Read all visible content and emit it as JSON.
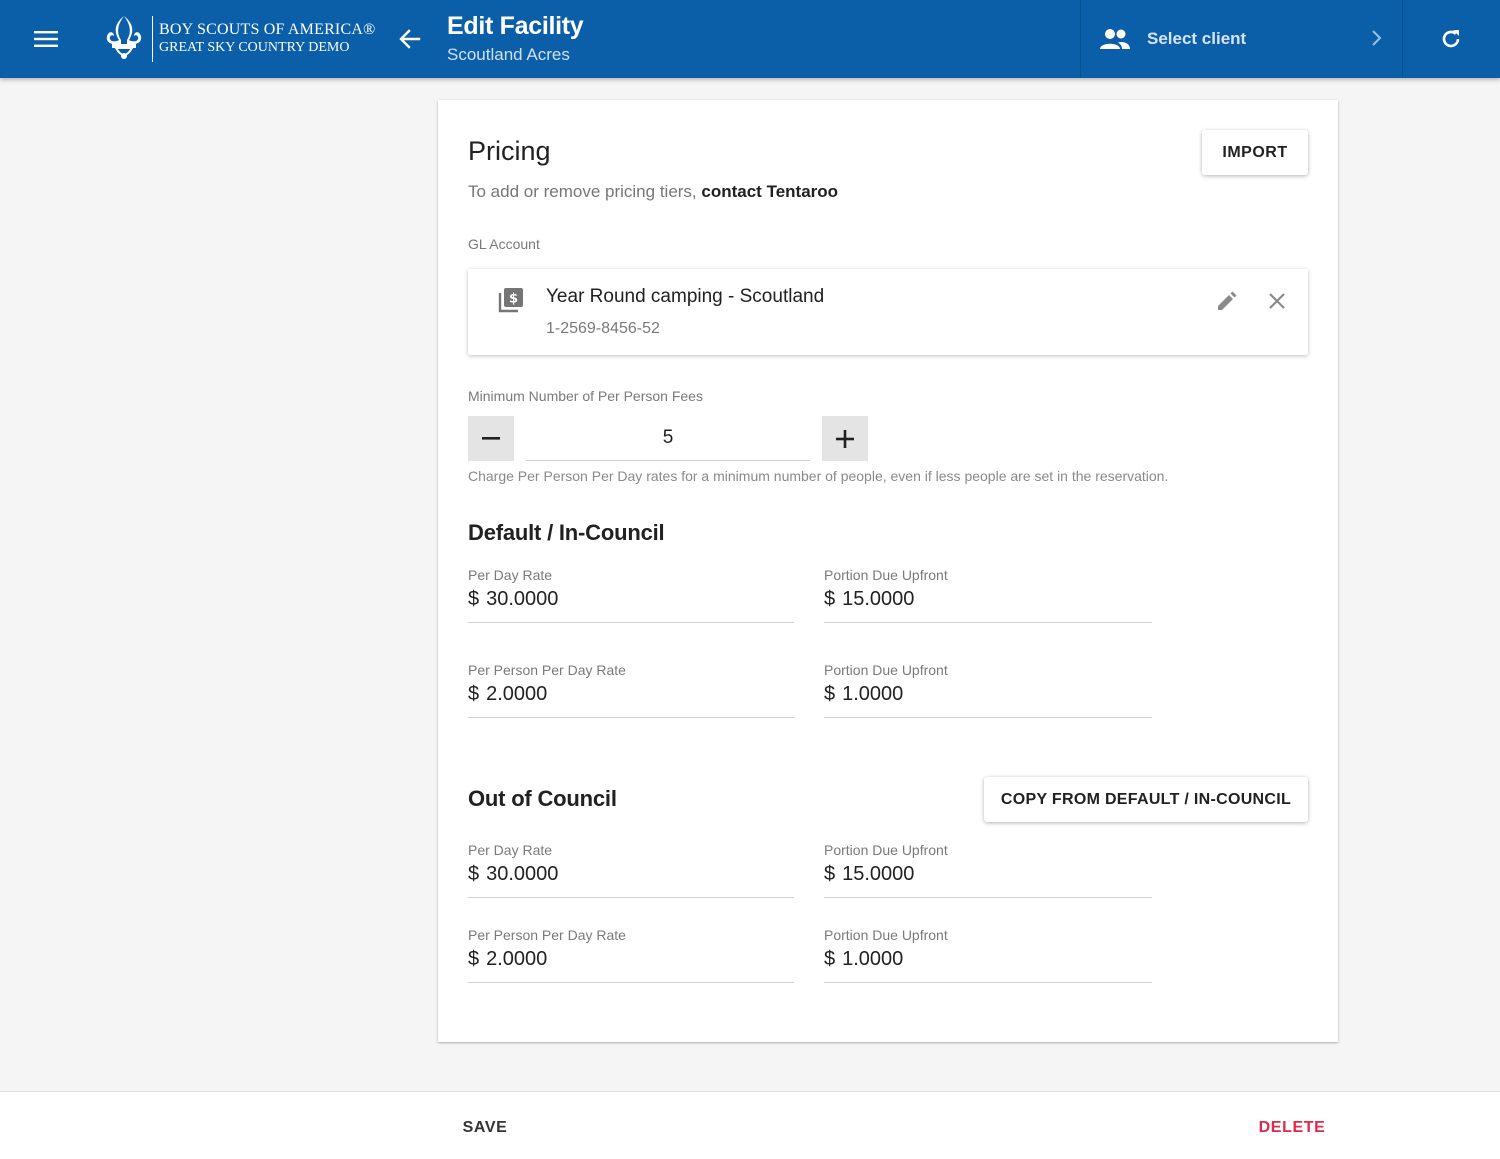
{
  "header": {
    "menu_icon": "menu-icon",
    "logo": {
      "line1": "BOY SCOUTS OF AMERICA®",
      "line2": "GREAT SKY COUNTRY DEMO"
    },
    "back_icon": "arrow-left-icon",
    "title": "Edit Facility",
    "subtitle": "Scoutland Acres",
    "client_selector": {
      "icon": "people-icon",
      "label": "Select client",
      "chevron": "chevron-right-icon"
    },
    "refresh_icon": "refresh-icon",
    "background_color": "#0b5fa8"
  },
  "pricing": {
    "title": "Pricing",
    "import_label": "IMPORT",
    "tiers_note": "To add or remove pricing tiers, ",
    "tiers_link": "contact Tentaroo",
    "gl_account": {
      "label": "GL Account",
      "icon": "dollar-library-icon",
      "name": "Year Round camping - Scoutland",
      "number": "1-2569-8456-52",
      "edit_icon": "pencil-icon",
      "remove_icon": "close-icon"
    },
    "min_fees": {
      "label": "Minimum Number of Per Person Fees",
      "value": "5",
      "minus_icon": "minus-icon",
      "plus_icon": "plus-icon",
      "helper": "Charge Per Person Per Day rates for a minimum number of people, even if less people are set in the reservation."
    },
    "default_council": {
      "title": "Default / In-Council",
      "per_day_rate": {
        "label": "Per Day Rate",
        "currency": "$",
        "value": "30.0000"
      },
      "per_day_upfront": {
        "label": "Portion Due Upfront",
        "currency": "$",
        "value": "15.0000"
      },
      "per_person_rate": {
        "label": "Per Person Per Day Rate",
        "currency": "$",
        "value": "2.0000"
      },
      "per_person_upfront": {
        "label": "Portion Due Upfront",
        "currency": "$",
        "value": "1.0000"
      }
    },
    "out_of_council": {
      "title": "Out of Council",
      "copy_label": "COPY FROM DEFAULT / IN-COUNCIL",
      "per_day_rate": {
        "label": "Per Day Rate",
        "currency": "$",
        "value": "30.0000"
      },
      "per_day_upfront": {
        "label": "Portion Due Upfront",
        "currency": "$",
        "value": "15.0000"
      },
      "per_person_rate": {
        "label": "Per Person Per Day Rate",
        "currency": "$",
        "value": "2.0000"
      },
      "per_person_upfront": {
        "label": "Portion Due Upfront",
        "currency": "$",
        "value": "1.0000"
      }
    }
  },
  "footer": {
    "save_label": "SAVE",
    "delete_label": "DELETE",
    "delete_color": "#e0284a"
  }
}
